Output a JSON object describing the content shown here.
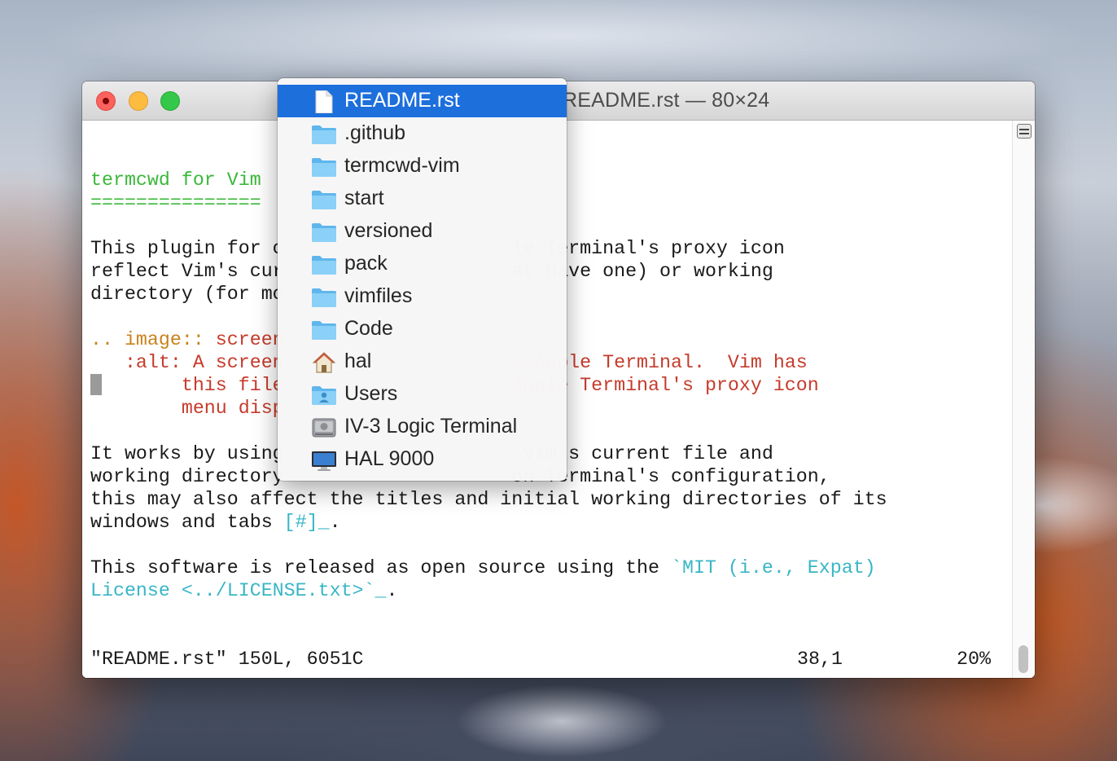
{
  "window": {
    "title": "README.rst — 80×24"
  },
  "editor": {
    "lines": [
      {
        "text": "termcwd for Vim",
        "color": "green"
      },
      {
        "text": "===============",
        "color": "green"
      },
      {
        "text": "",
        "color": "black"
      },
      {
        "text": "This plugin for c                    le Terminal's proxy icon",
        "color": "black"
      },
      {
        "text": "reflect Vim's cur                    at have one) or working",
        "color": "black"
      },
      {
        "text": "directory (for mo",
        "color": "black"
      },
      {
        "text": "",
        "color": "black"
      },
      {
        "text": ".. image:: screen",
        "color": "mixed"
      },
      {
        "text": "   :alt: A screen                    e Apple Terminal.  Vim has",
        "color": "red"
      },
      {
        "text": "        this file                    Apple Terminal's proxy icon",
        "color": "red"
      },
      {
        "text": "        menu disp",
        "color": "red"
      },
      {
        "text": "",
        "color": "black"
      },
      {
        "text": "It works by using                     Vim's current file and",
        "color": "black"
      },
      {
        "text": "working directory                    on Terminal's configuration,",
        "color": "black"
      },
      {
        "text": "this may also affect the titles and initial working directories of its",
        "color": "black"
      },
      {
        "text": "windows and tabs [#]_.",
        "color": "mixed"
      },
      {
        "text": "",
        "color": "black"
      },
      {
        "text": "This software is released as open source using the `MIT (i.e., Expat)",
        "color": "mixed"
      },
      {
        "text": "License <../LICENSE.txt>`_.",
        "color": "mixed"
      }
    ],
    "line_segments": {
      "image_directive": ".. image::",
      "image_arg": " screen",
      "windows_tabs_pre": "windows and tabs ",
      "windows_tabs_ref": "[#]_",
      "windows_tabs_post": ".",
      "mit_pre": "This software is released as open source using the ",
      "mit_link": "`MIT (i.e., Expat)",
      "license_link": "License <../LICENSE.txt>`_",
      "license_post": "."
    },
    "status_file": "\"README.rst\" 150L, 6051C",
    "status_pos": "38,1",
    "status_percent": "20%"
  },
  "proxy_menu": {
    "items": [
      {
        "label": "README.rst",
        "icon": "document-icon",
        "selected": true
      },
      {
        "label": ".github",
        "icon": "folder-icon",
        "selected": false
      },
      {
        "label": "termcwd-vim",
        "icon": "folder-icon",
        "selected": false
      },
      {
        "label": "start",
        "icon": "folder-icon",
        "selected": false
      },
      {
        "label": "versioned",
        "icon": "folder-icon",
        "selected": false
      },
      {
        "label": "pack",
        "icon": "folder-icon",
        "selected": false
      },
      {
        "label": "vimfiles",
        "icon": "folder-icon",
        "selected": false
      },
      {
        "label": "Code",
        "icon": "folder-icon",
        "selected": false
      },
      {
        "label": "hal",
        "icon": "home-icon",
        "selected": false
      },
      {
        "label": "Users",
        "icon": "users-folder-icon",
        "selected": false
      },
      {
        "label": "IV-3 Logic Terminal",
        "icon": "hard-drive-icon",
        "selected": false
      },
      {
        "label": "HAL 9000",
        "icon": "computer-icon",
        "selected": false
      }
    ]
  },
  "colors": {
    "selection": "#1d6fdc",
    "heading": "#3bb83a",
    "directive": "#c9821b",
    "option": "#c63b2b",
    "link": "#38b6c6"
  }
}
